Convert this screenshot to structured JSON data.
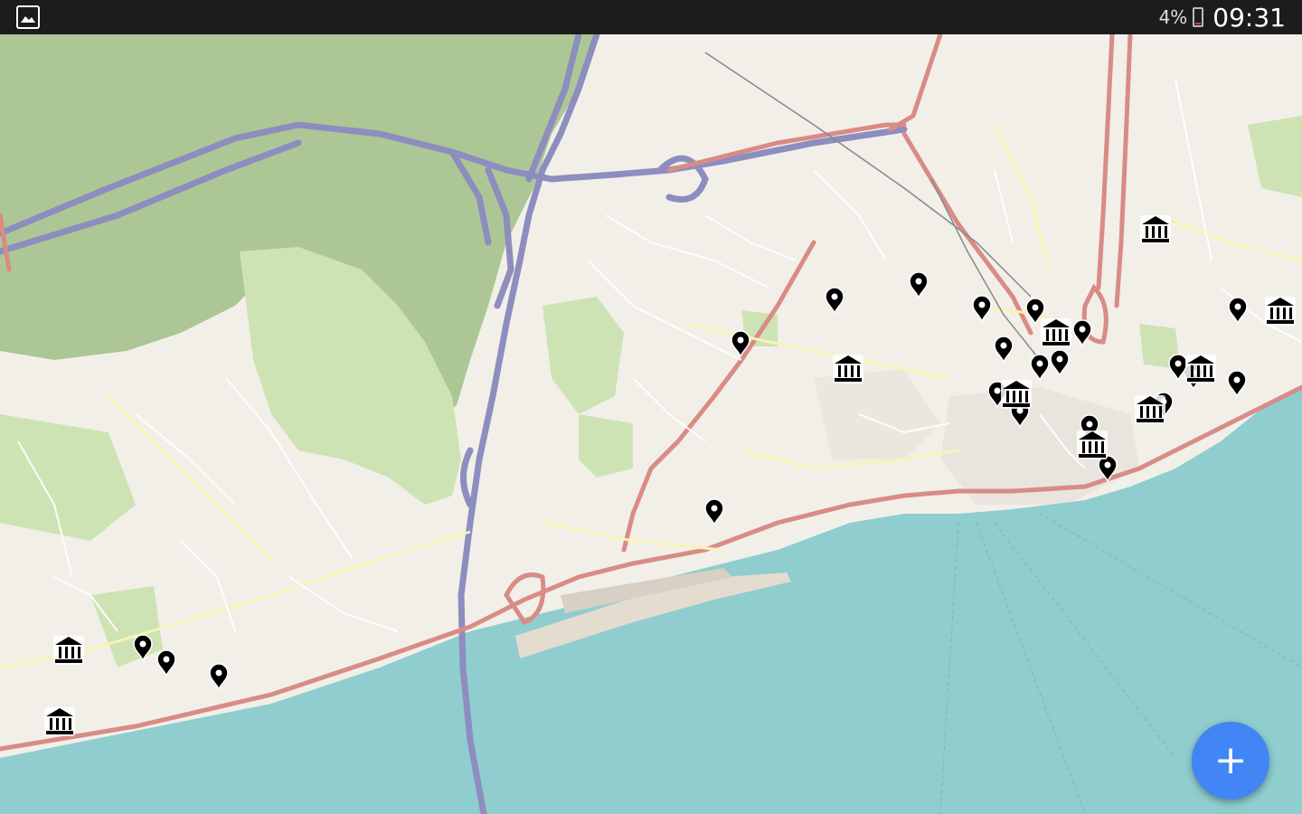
{
  "status_bar": {
    "battery_percent": "4%",
    "time": "09:31"
  },
  "fab": {
    "label": "+"
  },
  "colors": {
    "fab": "#4285f4",
    "water": "#8fcdcf",
    "land": "#f2efe9",
    "park": "#acc795",
    "primary_road": "#d98b86",
    "motorway": "#8d8dbf",
    "marker": "#000000"
  },
  "markers": [
    {
      "type": "pin"
    },
    {
      "type": "pin"
    },
    {
      "type": "pin"
    },
    {
      "type": "pin"
    },
    {
      "type": "pin"
    },
    {
      "type": "pin"
    },
    {
      "type": "pin"
    },
    {
      "type": "pin"
    },
    {
      "type": "pin"
    },
    {
      "type": "pin"
    },
    {
      "type": "pin"
    },
    {
      "type": "pin"
    },
    {
      "type": "pin"
    },
    {
      "type": "pin"
    },
    {
      "type": "pin"
    },
    {
      "type": "pin"
    },
    {
      "type": "pin"
    },
    {
      "type": "pin"
    },
    {
      "type": "pin"
    },
    {
      "type": "pin"
    },
    {
      "type": "pin"
    },
    {
      "type": "pin"
    },
    {
      "type": "museum"
    },
    {
      "type": "museum"
    },
    {
      "type": "museum"
    },
    {
      "type": "museum"
    },
    {
      "type": "museum"
    },
    {
      "type": "museum"
    },
    {
      "type": "museum"
    },
    {
      "type": "museum"
    },
    {
      "type": "museum"
    },
    {
      "type": "museum"
    }
  ]
}
